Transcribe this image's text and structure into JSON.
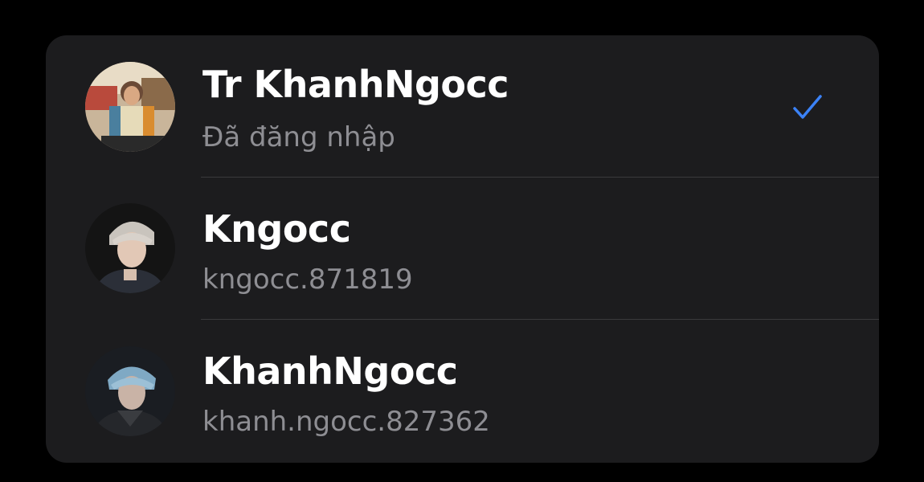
{
  "accounts": [
    {
      "name": "Tr KhanhNgocc",
      "subtitle": "Đã đăng nhập",
      "selected": true
    },
    {
      "name": "Kngocc",
      "subtitle": "kngocc.871819",
      "selected": false
    },
    {
      "name": "KhanhNgocc",
      "subtitle": "khanh.ngocc.827362",
      "selected": false
    }
  ],
  "icons": {
    "selected": "checkmark-icon"
  },
  "colors": {
    "background": "#000000",
    "panel": "#1c1c1e",
    "divider": "#3a3a3c",
    "primary_text": "#ffffff",
    "secondary_text": "#8e8e93",
    "accent": "#3b82f6"
  }
}
